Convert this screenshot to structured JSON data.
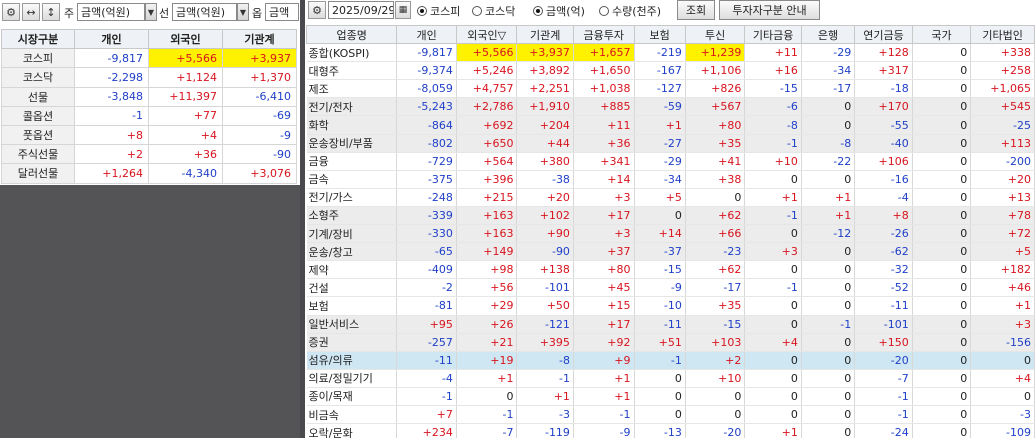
{
  "left_toolbar": {
    "label_ju": "주",
    "dropdown1": "금액(억원)",
    "label_seon": "선",
    "dropdown2": "금액(억원)",
    "label_eup": "옵",
    "dropdown3": "금액"
  },
  "left_table": {
    "headers": [
      "시장구분",
      "개인",
      "외국인",
      "기관계"
    ],
    "rows": [
      [
        "코스피",
        "-9,817",
        "+5,566",
        "+3,937"
      ],
      [
        "코스닥",
        "-2,298",
        "+1,124",
        "+1,370"
      ],
      [
        "선물",
        "-3,848",
        "+11,397",
        "-6,410"
      ],
      [
        "콜옵션",
        "-1",
        "+77",
        "-69"
      ],
      [
        "풋옵션",
        "+8",
        "+4",
        "-9"
      ],
      [
        "주식선물",
        "+2",
        "+36",
        "-90"
      ],
      [
        "달러선물",
        "+1,264",
        "-4,340",
        "+3,076"
      ]
    ]
  },
  "right_toolbar": {
    "date": "2025/09/29",
    "market_options": [
      "코스피",
      "코스닥"
    ],
    "market_selected": "코스피",
    "unit_options": [
      "금액(억)",
      "수량(천주)"
    ],
    "unit_selected": "금액(억)",
    "search_button": "조회",
    "guide_button": "투자자구분 안내"
  },
  "right_table": {
    "headers": [
      "업종명",
      "개인",
      "외국인▽",
      "기관계",
      "금융투자",
      "보험",
      "투신",
      "기타금융",
      "은행",
      "연기금등",
      "국가",
      "기타법인"
    ],
    "rows": [
      [
        "종합(KOSPI)",
        "-9,817",
        "+5,566",
        "+3,937",
        "+1,657",
        "-219",
        "+1,239",
        "+11",
        "-29",
        "+128",
        "0",
        "+338"
      ],
      [
        "대형주",
        "-9,374",
        "+5,246",
        "+3,892",
        "+1,650",
        "-167",
        "+1,106",
        "+16",
        "-34",
        "+317",
        "0",
        "+258"
      ],
      [
        "제조",
        "-8,059",
        "+4,757",
        "+2,251",
        "+1,038",
        "-127",
        "+826",
        "-15",
        "-17",
        "-18",
        "0",
        "+1,065"
      ],
      [
        "전기/전자",
        "-5,243",
        "+2,786",
        "+1,910",
        "+885",
        "-59",
        "+567",
        "-6",
        "0",
        "+170",
        "0",
        "+545"
      ],
      [
        "화학",
        "-864",
        "+692",
        "+204",
        "+11",
        "+1",
        "+80",
        "-8",
        "0",
        "-55",
        "0",
        "-25"
      ],
      [
        "운송장비/부품",
        "-802",
        "+650",
        "+44",
        "+36",
        "-27",
        "+35",
        "-1",
        "-8",
        "-40",
        "0",
        "+113"
      ],
      [
        "금융",
        "-729",
        "+564",
        "+380",
        "+341",
        "-29",
        "+41",
        "+10",
        "-22",
        "+106",
        "0",
        "-200"
      ],
      [
        "금속",
        "-375",
        "+396",
        "-38",
        "+14",
        "-34",
        "+38",
        "0",
        "0",
        "-16",
        "0",
        "+20"
      ],
      [
        "전기/가스",
        "-248",
        "+215",
        "+20",
        "+3",
        "+5",
        "0",
        "+1",
        "+1",
        "-4",
        "0",
        "+13"
      ],
      [
        "소형주",
        "-339",
        "+163",
        "+102",
        "+17",
        "0",
        "+62",
        "-1",
        "+1",
        "+8",
        "0",
        "+78"
      ],
      [
        "기계/장비",
        "-330",
        "+163",
        "+90",
        "+3",
        "+14",
        "+66",
        "0",
        "-12",
        "-26",
        "0",
        "+72"
      ],
      [
        "운송/창고",
        "-65",
        "+149",
        "-90",
        "+37",
        "-37",
        "-23",
        "+3",
        "0",
        "-62",
        "0",
        "+5"
      ],
      [
        "제약",
        "-409",
        "+98",
        "+138",
        "+80",
        "-15",
        "+62",
        "0",
        "0",
        "-32",
        "0",
        "+182"
      ],
      [
        "건설",
        "-2",
        "+56",
        "-101",
        "+45",
        "-9",
        "-17",
        "-1",
        "0",
        "-52",
        "0",
        "+46"
      ],
      [
        "보험",
        "-81",
        "+29",
        "+50",
        "+15",
        "-10",
        "+35",
        "0",
        "0",
        "-11",
        "0",
        "+1"
      ],
      [
        "일반서비스",
        "+95",
        "+26",
        "-121",
        "+17",
        "-11",
        "-15",
        "0",
        "-1",
        "-101",
        "0",
        "+3"
      ],
      [
        "증권",
        "-257",
        "+21",
        "+395",
        "+92",
        "+51",
        "+103",
        "+4",
        "0",
        "+150",
        "0",
        "-156"
      ],
      [
        "섬유/의류",
        "-11",
        "+19",
        "-8",
        "+9",
        "-1",
        "+2",
        "0",
        "0",
        "-20",
        "0",
        "0"
      ],
      [
        "의료/정밀기기",
        "-4",
        "+1",
        "-1",
        "+1",
        "0",
        "+10",
        "0",
        "0",
        "-7",
        "0",
        "+4"
      ],
      [
        "종이/목재",
        "-1",
        "0",
        "+1",
        "+1",
        "0",
        "0",
        "0",
        "0",
        "-1",
        "0",
        "0"
      ],
      [
        "비금속",
        "+7",
        "-1",
        "-3",
        "-1",
        "0",
        "0",
        "0",
        "0",
        "-1",
        "0",
        "-3"
      ],
      [
        "오락/문화",
        "+234",
        "-7",
        "-119",
        "-9",
        "-13",
        "-20",
        "+1",
        "0",
        "-24",
        "0",
        "-109"
      ]
    ]
  }
}
